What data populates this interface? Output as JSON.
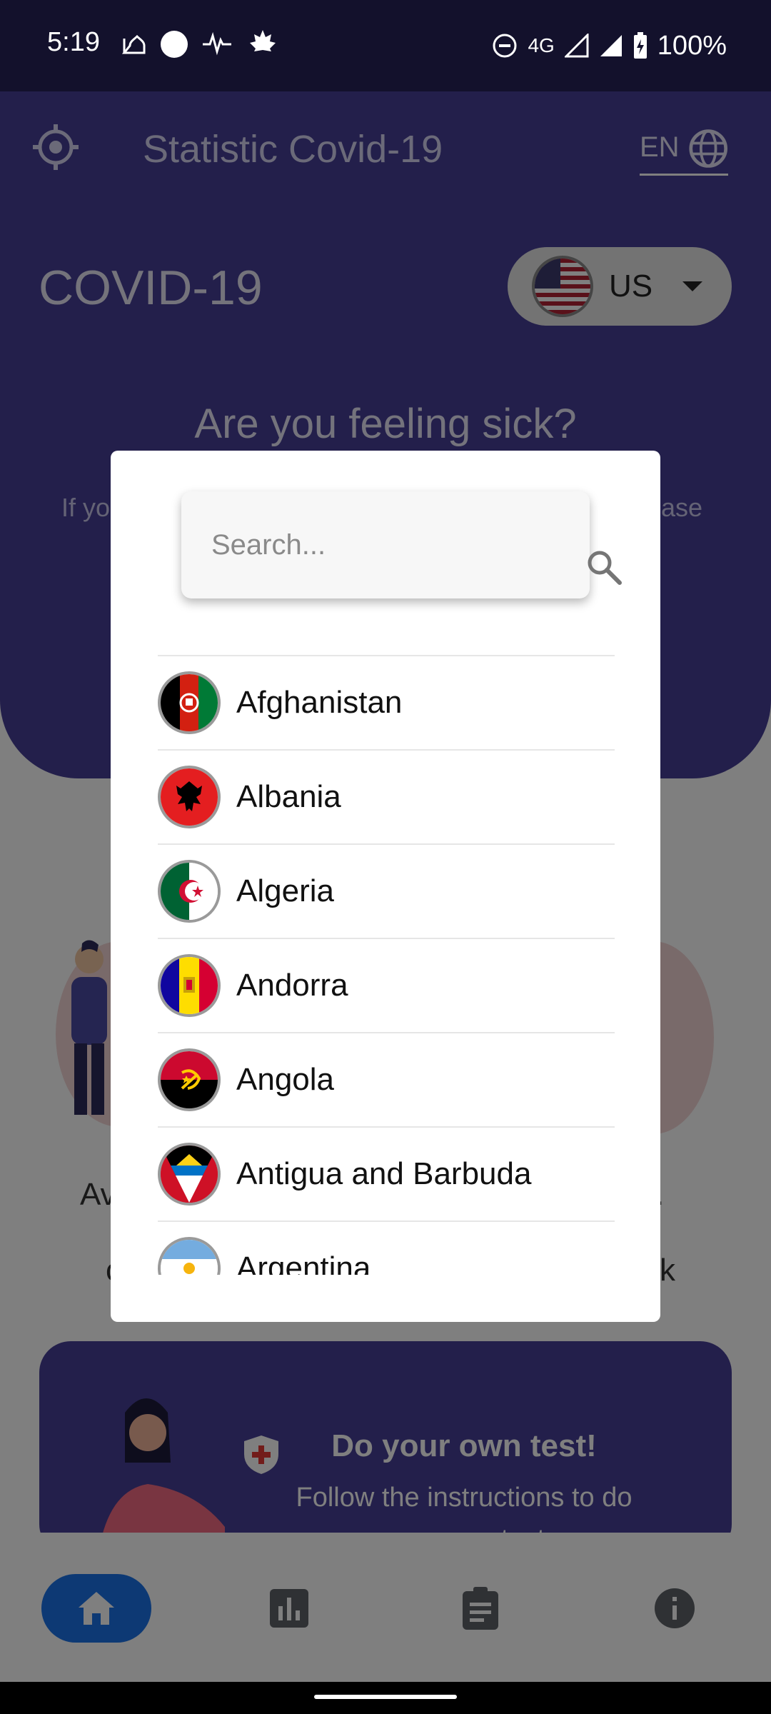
{
  "status_bar": {
    "time": "5:19",
    "network": "4G",
    "battery": "100%"
  },
  "app_bar": {
    "title": "Statistic Covid-19",
    "language": "EN"
  },
  "hero": {
    "title": "COVID-19",
    "selected_country": "US",
    "sick_title": "Are you feeling sick?",
    "sick_body_left": "If yo",
    "sick_body_right": "ease"
  },
  "prevention": {
    "left_text_1": "Av",
    "left_text_2": "c",
    "right_text_1": ".",
    "right_text_2": "sk"
  },
  "test_card": {
    "title": "Do your own test!",
    "subtitle_1": "Follow the instructions to do",
    "subtitle_2": "your own test"
  },
  "country_dialog": {
    "search_placeholder": "Search...",
    "countries": [
      {
        "name": "Afghanistan",
        "flag": "flag-afghanistan"
      },
      {
        "name": "Albania",
        "flag": "flag-albania"
      },
      {
        "name": "Algeria",
        "flag": "flag-algeria"
      },
      {
        "name": "Andorra",
        "flag": "flag-andorra"
      },
      {
        "name": "Angola",
        "flag": "flag-angola"
      },
      {
        "name": "Antigua and Barbuda",
        "flag": "flag-antigua-and-barbuda"
      },
      {
        "name": "Argentina",
        "flag": "flag-argentina"
      }
    ]
  },
  "bottom_nav": {
    "items": [
      "home-icon",
      "bar-chart-icon",
      "clipboard-icon",
      "info-icon"
    ],
    "active": "home-icon",
    "active_color": "#1a73e8"
  },
  "colors": {
    "primary": "#473f97",
    "status_bar": "#13112c"
  }
}
